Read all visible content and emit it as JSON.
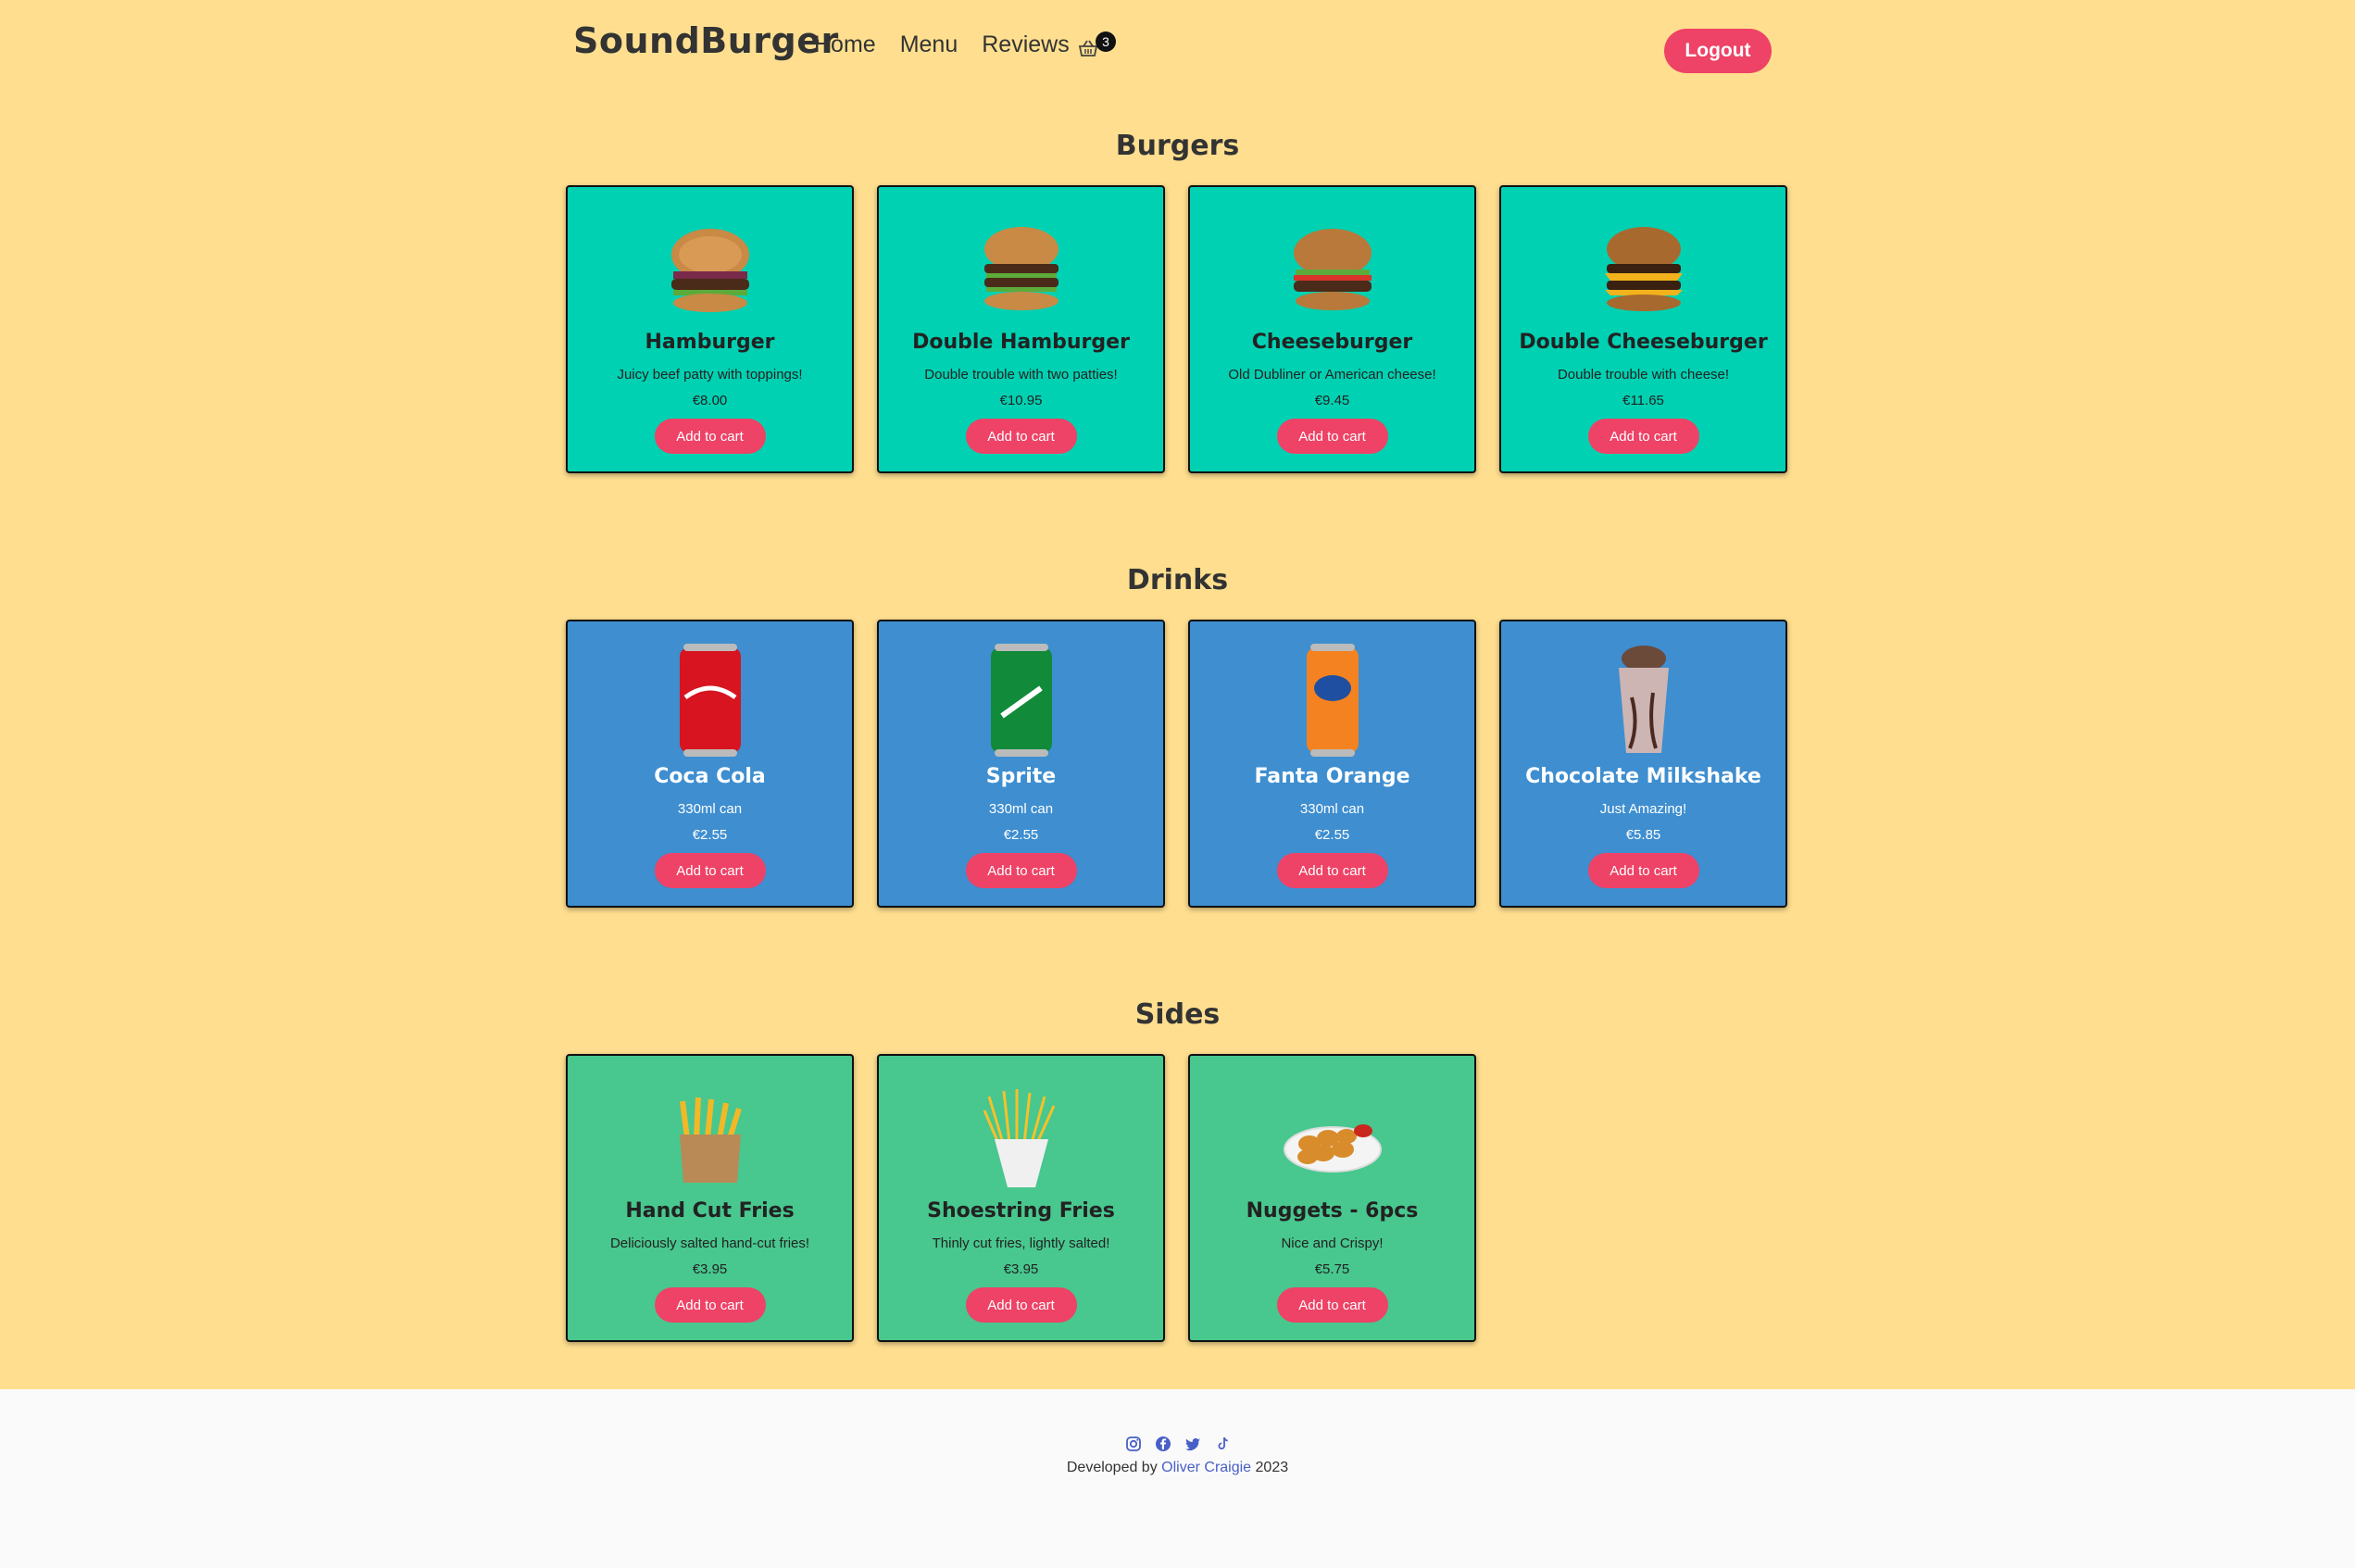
{
  "nav": {
    "brand": "SoundBurger",
    "links": [
      "Home",
      "Menu",
      "Reviews"
    ],
    "cart_count": "3",
    "logout": "Logout"
  },
  "sections": [
    {
      "title": "Burgers",
      "items": [
        {
          "name": "Hamburger",
          "desc": "Juicy beef patty with toppings!",
          "price": "€8.00",
          "button": "Add to cart"
        },
        {
          "name": "Double Hamburger",
          "desc": "Double trouble with two patties!",
          "price": "€10.95",
          "button": "Add to cart"
        },
        {
          "name": "Cheeseburger",
          "desc": "Old Dubliner or American cheese!",
          "price": "€9.45",
          "button": "Add to cart"
        },
        {
          "name": "Double Cheeseburger",
          "desc": "Double trouble with cheese!",
          "price": "€11.65",
          "button": "Add to cart"
        }
      ]
    },
    {
      "title": "Drinks",
      "items": [
        {
          "name": "Coca Cola",
          "desc": "330ml can",
          "price": "€2.55",
          "button": "Add to cart"
        },
        {
          "name": "Sprite",
          "desc": "330ml can",
          "price": "€2.55",
          "button": "Add to cart"
        },
        {
          "name": "Fanta Orange",
          "desc": "330ml can",
          "price": "€2.55",
          "button": "Add to cart"
        },
        {
          "name": "Chocolate Milkshake",
          "desc": "Just Amazing!",
          "price": "€5.85",
          "button": "Add to cart"
        }
      ]
    },
    {
      "title": "Sides",
      "items": [
        {
          "name": "Hand Cut Fries",
          "desc": "Deliciously salted hand-cut fries!",
          "price": "€3.95",
          "button": "Add to cart"
        },
        {
          "name": "Shoestring Fries",
          "desc": "Thinly cut fries, lightly salted!",
          "price": "€3.95",
          "button": "Add to cart"
        },
        {
          "name": "Nuggets - 6pcs",
          "desc": "Nice and Crispy!",
          "price": "€5.75",
          "button": "Add to cart"
        }
      ]
    }
  ],
  "footer": {
    "prefix": "Developed by",
    "author": "Oliver Craigie",
    "year": "2023",
    "icons": [
      "instagram-icon",
      "facebook-icon",
      "twitter-icon",
      "tiktok-icon"
    ]
  },
  "colors": {
    "page_bg": "#ffdf8f",
    "burger_card": "#00d1b2",
    "drink_card": "#3e8ed0",
    "side_card": "#48c78e",
    "button": "#ee4266",
    "link": "#485fc7"
  },
  "images": {
    "burgers": [
      "hamburger-image",
      "double-hamburger-image",
      "cheeseburger-image",
      "double-cheeseburger-image"
    ],
    "drinks": [
      "coca-cola-can-image",
      "sprite-can-image",
      "fanta-can-image",
      "milkshake-image"
    ],
    "sides": [
      "hand-cut-fries-image",
      "shoestring-fries-image",
      "nuggets-image"
    ]
  }
}
